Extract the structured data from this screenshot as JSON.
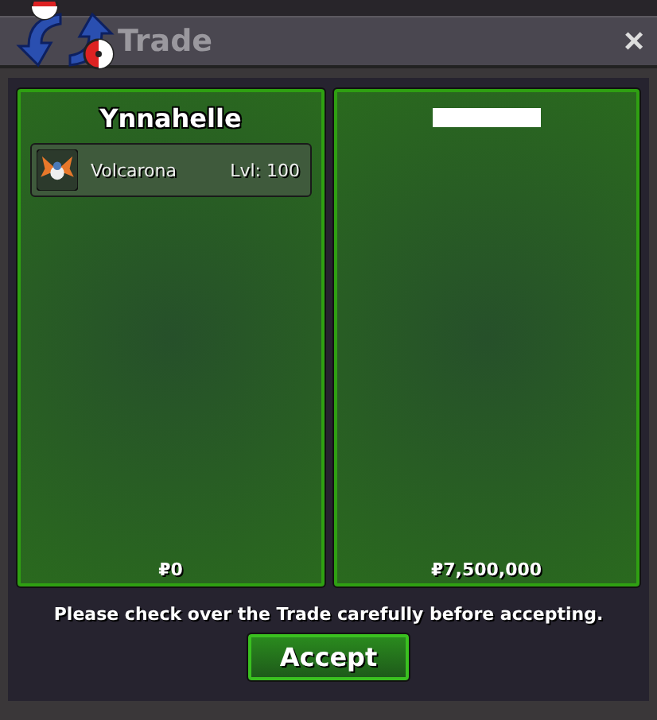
{
  "window": {
    "title": "Trade",
    "close": "×"
  },
  "panels": [
    {
      "owner": "Ynnahelle",
      "name_redacted": false,
      "items": [
        {
          "name": "Volcarona",
          "level_text": "Lvl: 100"
        }
      ],
      "money": "₽0"
    },
    {
      "name_redacted": true,
      "money": "₽7,500,000"
    }
  ],
  "message": "Please check over the Trade carefully before accepting.",
  "buttons": [
    "Accept"
  ]
}
